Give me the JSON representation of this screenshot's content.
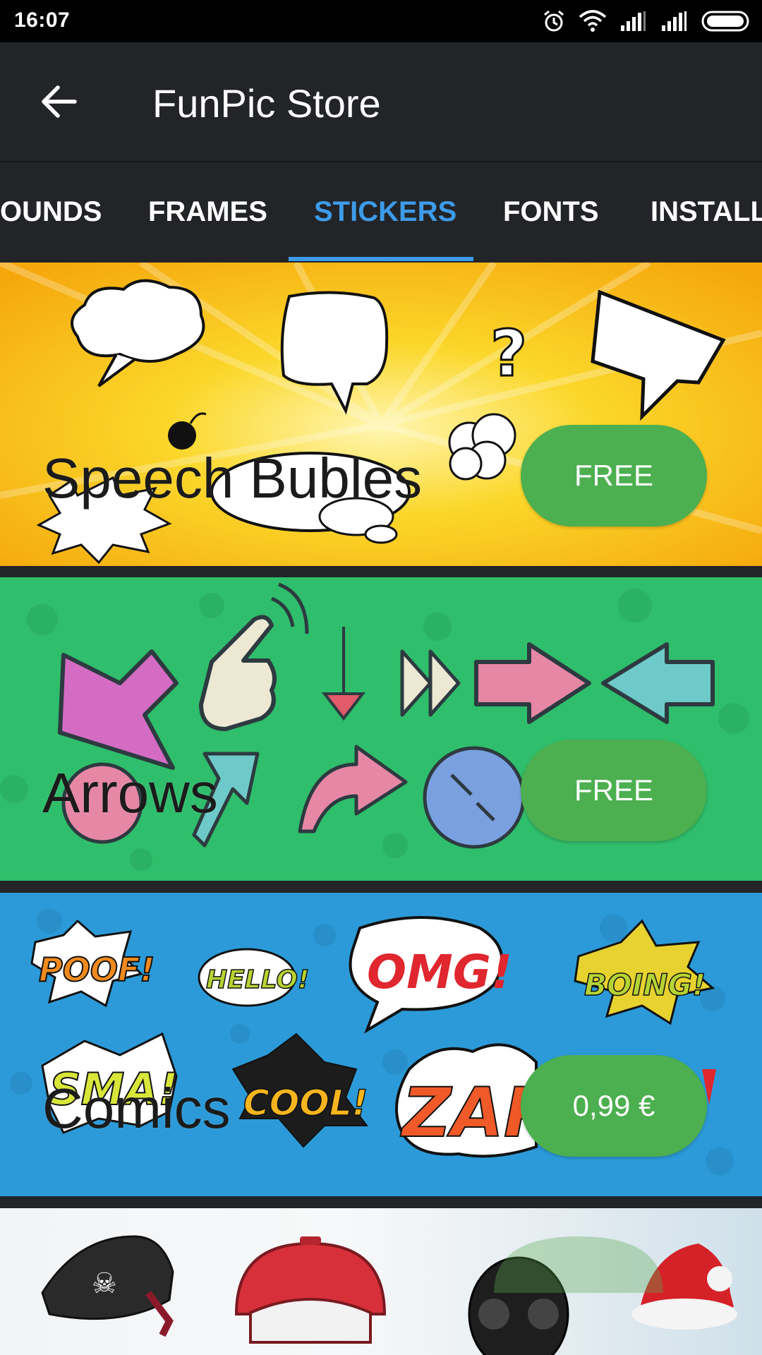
{
  "status_bar": {
    "time": "16:07"
  },
  "app_bar": {
    "title": "FunPic Store"
  },
  "tabs": [
    {
      "label": "OUNDS"
    },
    {
      "label": "FRAMES"
    },
    {
      "label": "STICKERS",
      "active": true
    },
    {
      "label": "FONTS"
    },
    {
      "label": "INSTALL"
    }
  ],
  "cards": [
    {
      "title": "Speech Bubles",
      "price": "FREE",
      "background": "#f7c514"
    },
    {
      "title": "Arrows",
      "price": "FREE",
      "background": "#2fbe6b"
    },
    {
      "title": "Comics",
      "price": "0,99 €",
      "background": "#2c9ad8"
    }
  ],
  "colors": {
    "accent": "#3d9be9",
    "button": "#4caf50",
    "toolbar": "#222428"
  }
}
